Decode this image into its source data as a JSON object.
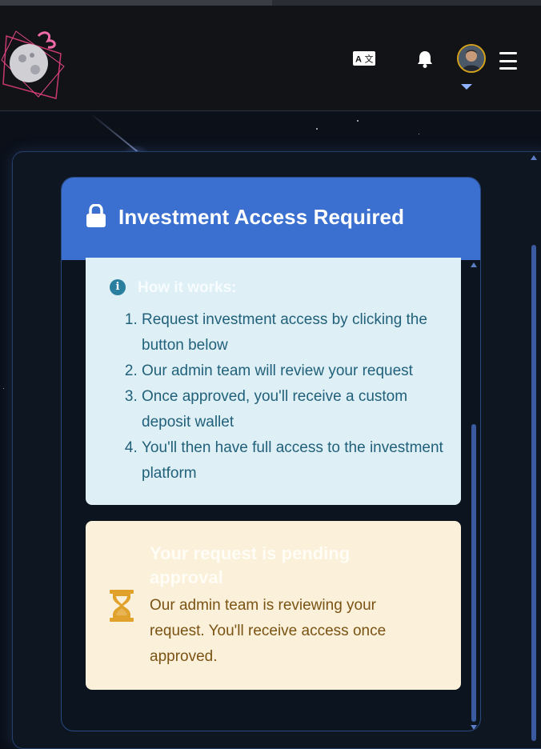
{
  "header": {
    "logo_icon": "moon-logo-icon",
    "translate_icon": "translate-icon",
    "notifications_icon": "bell-icon",
    "avatar_icon": "user-avatar",
    "menu_icon": "hamburger-menu-icon"
  },
  "card": {
    "title": "Investment Access Required",
    "title_icon": "lock-icon",
    "header_color": "#3b70d0"
  },
  "info": {
    "heading": "How it works:",
    "icon": "info-circle-icon",
    "steps": [
      "Request investment access by clicking the button below",
      "Our admin team will review your request",
      "Once approved, you'll receive a custom deposit wallet",
      "You'll then have full access to the investment platform"
    ]
  },
  "pending": {
    "icon": "hourglass-icon",
    "title": "Your request is pending approval",
    "text": "Our admin team is reviewing your request. You'll receive access once approved."
  },
  "colors": {
    "accent": "#3b70d0",
    "info_bg": "#def0f6",
    "warning_bg": "#fbf0d9",
    "warning_icon": "#e0a22a"
  }
}
